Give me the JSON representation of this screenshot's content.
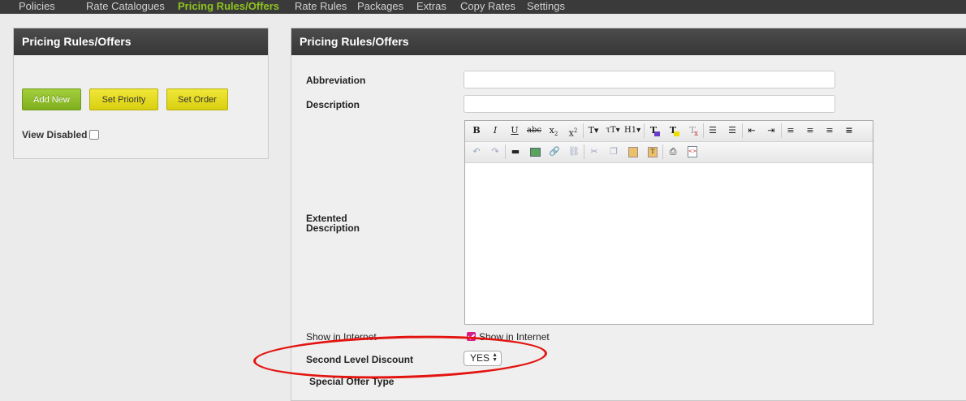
{
  "topnav": {
    "items": [
      {
        "label": "Policies"
      },
      {
        "label": "Rate Catalogues"
      },
      {
        "label": "Pricing Rules/Offers"
      },
      {
        "label": "Rate Rules"
      },
      {
        "label": "Packages"
      },
      {
        "label": "Extras"
      },
      {
        "label": "Copy Rates"
      },
      {
        "label": "Settings"
      }
    ],
    "active_index": 2
  },
  "left_panel": {
    "title": "Pricing Rules/Offers",
    "buttons": {
      "add_new": "Add New",
      "set_priority": "Set Priority",
      "set_order": "Set Order"
    },
    "view_disabled_label": "View Disabled",
    "view_disabled_checked": false
  },
  "right_panel": {
    "title": "Pricing Rules/Offers",
    "fields": {
      "abbreviation_label": "Abbreviation",
      "abbreviation_value": "",
      "description_label": "Description",
      "description_value": "",
      "extended_description_label_line1": "Extented",
      "extended_description_label_line2": "Description",
      "show_in_internet_label": "Show in Internet",
      "show_in_internet_checkbox_label": "Show in Internet",
      "show_in_internet_checked": true,
      "second_level_discount_label": "Second Level Discount",
      "second_level_discount_value": "YES",
      "special_offer_type_label": "Special Offer Type"
    },
    "editor_toolbar": {
      "row1": [
        "bold-icon",
        "italic-icon",
        "underline-icon",
        "strikethrough-icon",
        "subscript-icon",
        "superscript-icon",
        "font-size-icon",
        "font-family-icon",
        "heading-icon",
        "text-color-icon",
        "highlight-icon",
        "clear-format-icon",
        "bullet-list-icon",
        "numbered-list-icon",
        "outdent-icon",
        "indent-icon",
        "align-left-icon",
        "align-center-icon",
        "align-right-icon",
        "justify-icon"
      ],
      "row2": [
        "undo-icon",
        "redo-icon",
        "horizontal-rule-icon",
        "image-icon",
        "link-icon",
        "unlink-icon",
        "cut-icon",
        "copy-icon",
        "paste-icon",
        "paste-text-icon",
        "print-icon",
        "source-code-icon"
      ]
    }
  },
  "colors": {
    "active_nav": "#8fc31f",
    "add_button": "#8fbf2a",
    "yellow_button": "#e6dd1e",
    "annotation": "#e3140f",
    "checkbox_checked": "#d81b8a"
  }
}
